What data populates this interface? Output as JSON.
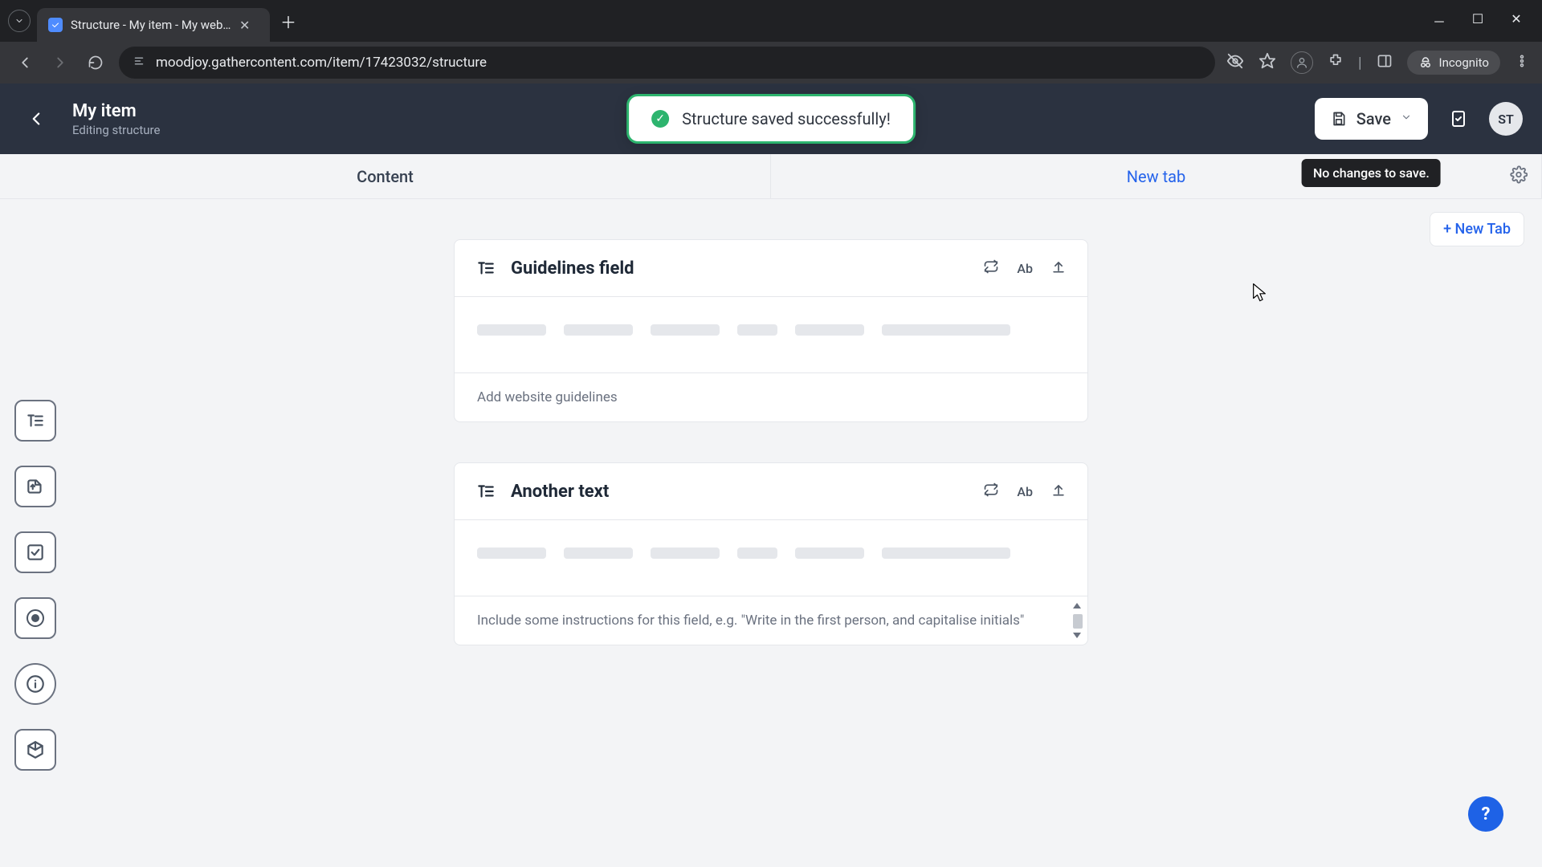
{
  "browser": {
    "tab_title": "Structure - My item - My websi",
    "url": "moodjoy.gathercontent.com/item/17423032/structure",
    "incognito_label": "Incognito"
  },
  "header": {
    "title": "My item",
    "subtitle": "Editing structure",
    "save_label": "Save",
    "tooltip": "No changes to save.",
    "avatar_initials": "ST"
  },
  "toast": {
    "message": "Structure saved successfully!"
  },
  "tabs": {
    "content": "Content",
    "new_tab": "New tab",
    "add_button": "+ New Tab"
  },
  "fields": [
    {
      "title": "Guidelines field",
      "footer": "Add website guidelines",
      "scrollable": false
    },
    {
      "title": "Another text",
      "footer": "Include some instructions for this field, e.g. \"Write in the first person, and capitalise initials\"",
      "scrollable": true
    }
  ],
  "icons": {
    "ab": "Ab"
  },
  "help": "?"
}
